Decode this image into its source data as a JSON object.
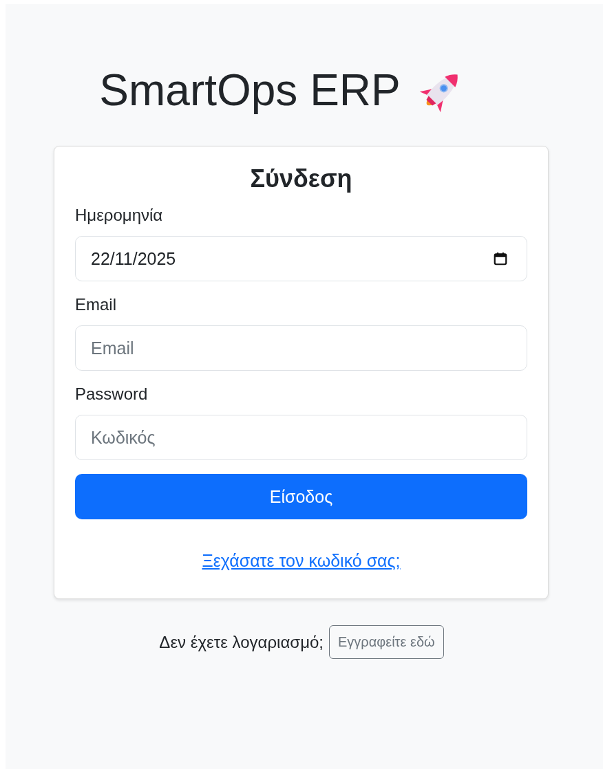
{
  "app_title": "SmartOps ERP",
  "login_card": {
    "heading": "Σύνδεση",
    "fields": [
      {
        "kind": "date",
        "label": "Ημερομηνία",
        "value": "22/11/2025"
      },
      {
        "kind": "email",
        "label": "Email",
        "placeholder": "Email"
      },
      {
        "kind": "password",
        "label": "Password",
        "placeholder": "Κωδικός"
      }
    ],
    "submit_button": "Είσοδος",
    "forgot_link": "Ξεχάσατε τον κωδικό σας;"
  },
  "signup_prompt": "Δεν έχετε λογαριασμό;",
  "signup_button": "Εγγραφείτε εδώ"
}
